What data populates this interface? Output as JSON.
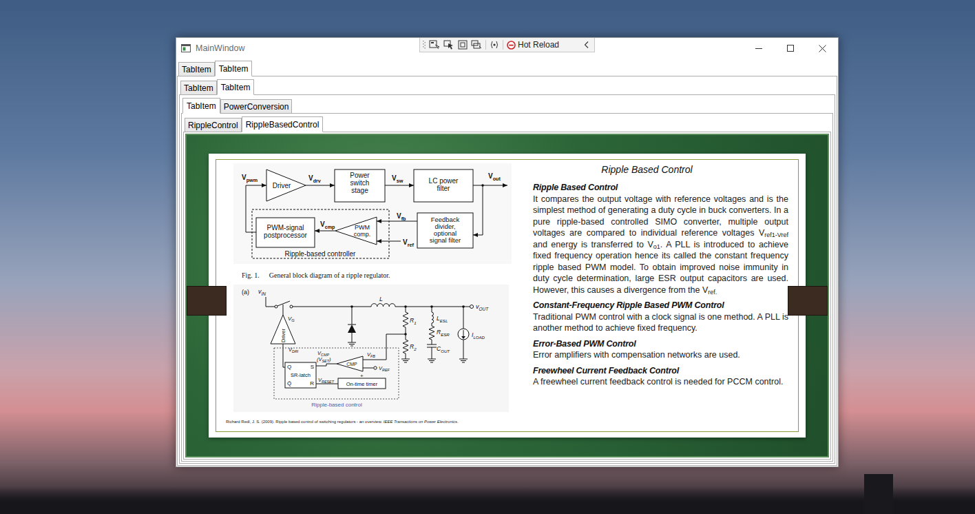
{
  "window": {
    "title": "MainWindow"
  },
  "debug_toolbar": {
    "hot_reload": "Hot Reload"
  },
  "tab_rows": [
    {
      "tabs": [
        {
          "label": "TabItem",
          "selected": false
        },
        {
          "label": "TabItem",
          "selected": true
        }
      ]
    },
    {
      "tabs": [
        {
          "label": "TabItem",
          "selected": false
        },
        {
          "label": "TabItem",
          "selected": true
        }
      ]
    },
    {
      "tabs": [
        {
          "label": "TabItem",
          "selected": true
        },
        {
          "label": "PowerConversion",
          "selected": false
        }
      ]
    },
    {
      "tabs": [
        {
          "label": "RippleControl",
          "selected": false
        },
        {
          "label": "RippleBasedControl",
          "selected": true
        }
      ]
    }
  ],
  "slide": {
    "title": "Ripple Based Control",
    "sections": [
      {
        "heading": "Ripple Based Control",
        "runs": [
          {
            "text": "It compares the output voltage with reference voltages and is the simplest method of generating a duty cycle in buck converters. In a pure ripple-based controlled SIMO converter, multiple output voltages are compared to individual reference voltages V",
            "sub": false
          },
          {
            "text": "ref1-Vref",
            "sub": true
          },
          {
            "text": " and energy is transferred to V",
            "sub": false
          },
          {
            "text": "o1",
            "sub": true
          },
          {
            "text": ". A PLL is introduced to achieve fixed frequency operation hence its called the constant frequency ripple based PWM model. To obtain improved noise immunity in duty cycle determination, large ESR output capacitors are used. However, this causes a divergence from the V",
            "sub": false
          },
          {
            "text": "ref.",
            "sub": true
          }
        ]
      },
      {
        "heading": "Constant-Frequency Ripple Based PWM Control",
        "runs": [
          {
            "text": "Traditional PWM control with a clock signal is one method. A PLL is another method to achieve fixed frequency.",
            "sub": false
          }
        ]
      },
      {
        "heading": "Error-Based PWM Control",
        "runs": [
          {
            "text": "Error amplifiers with compensation networks are used.",
            "sub": false
          }
        ]
      },
      {
        "heading": "Freewheel Current Feedback Control",
        "runs": [
          {
            "text": "A freewheel current feedback control is needed for PCCM control.",
            "sub": false
          }
        ]
      }
    ],
    "figure1": {
      "driver": "Driver",
      "blocks": [
        {
          "lines": [
            "Power",
            "switch",
            "stage"
          ]
        },
        {
          "lines": [
            "LC power",
            "filter"
          ]
        },
        {
          "lines": [
            "Feedback",
            "divider,",
            "optional",
            "signal filter"
          ]
        },
        {
          "lines": [
            "PWM-signal",
            "postprocessor"
          ]
        }
      ],
      "comparator": [
        "PWM",
        "comp."
      ],
      "signals": [
        {
          "text": "V",
          "sub": "pwm"
        },
        {
          "text": "V",
          "sub": "drv"
        },
        {
          "text": "V",
          "sub": "sw"
        },
        {
          "text": "V",
          "sub": "out"
        },
        {
          "text": "V",
          "sub": "fb"
        },
        {
          "text": "V",
          "sub": "cmp"
        },
        {
          "text": "V",
          "sub": "ref"
        }
      ],
      "controller_label": "Ripple-based controller",
      "caption": {
        "number": "Fig. 1.",
        "text": "General block diagram of a ripple regulator."
      }
    },
    "figure2": {
      "labels": [
        {
          "text": "(a)"
        },
        {
          "text": "v",
          "sub": "IN"
        },
        {
          "text": "L"
        },
        {
          "text": "v",
          "sub": "OUT"
        },
        {
          "text": "R",
          "sub": "1"
        },
        {
          "text": "R",
          "sub": "2"
        },
        {
          "text": "L",
          "sub": "ESL"
        },
        {
          "text": "R",
          "sub": "ESR"
        },
        {
          "text": "C",
          "sub": "OUT"
        },
        {
          "text": "I",
          "sub": "LOAD"
        },
        {
          "text": "V",
          "sub": "G"
        },
        {
          "text": "V",
          "sub": "DRI"
        },
        {
          "text": "V",
          "sub": "CMP"
        },
        {
          "text": "(V",
          "sub": "SET",
          "tail": ")"
        },
        {
          "text": "V",
          "sub": "FB"
        },
        {
          "text": "V",
          "sub": "REF"
        },
        {
          "text": "V",
          "sub": "RESET"
        },
        {
          "text": "+"
        }
      ],
      "driver": "Driver",
      "latch": {
        "q": "Q",
        "s": "S",
        "name": "SR-latch",
        "qbar": "Q̄",
        "r": "R"
      },
      "comparator": "CMP",
      "timer": "On-time timer",
      "control_label": "Ripple-based control"
    },
    "citation": [
      {
        "text": "Richard Redl, J. S. (2009). Ripple based control of switching regulators - an overview. ",
        "italic": false
      },
      {
        "text": "IEEE Transactions on Power Electronics",
        "italic": true
      },
      {
        "text": ".",
        "italic": false
      }
    ]
  }
}
